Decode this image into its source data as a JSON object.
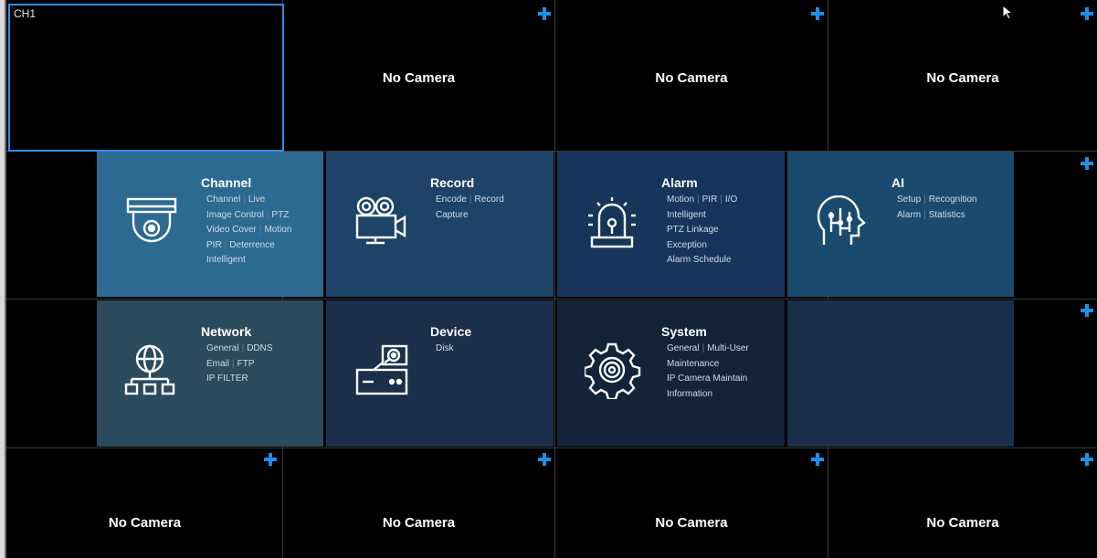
{
  "top_row": {
    "channel_label": "CH1",
    "cells": [
      "No Camera",
      "No Camera",
      "No Camera"
    ]
  },
  "bottom_row": {
    "cells": [
      "No Camera",
      "No Camera",
      "No Camera",
      "No Camera"
    ]
  },
  "menu": {
    "channel": {
      "title": "Channel",
      "lines": [
        [
          "Channel",
          "Live"
        ],
        [
          "Image Control",
          "PTZ"
        ],
        [
          "Video Cover",
          "Motion"
        ],
        [
          "PIR",
          "Deterrence"
        ],
        [
          "Intelligent"
        ]
      ]
    },
    "record": {
      "title": "Record",
      "lines": [
        [
          "Encode",
          "Record"
        ],
        [
          "Capture"
        ]
      ]
    },
    "alarm": {
      "title": "Alarm",
      "lines": [
        [
          "Motion",
          "PIR",
          "I/O"
        ],
        [
          "Intelligent"
        ],
        [
          "PTZ Linkage"
        ],
        [
          "Exception"
        ],
        [
          "Alarm Schedule"
        ]
      ]
    },
    "ai": {
      "title": "AI",
      "lines": [
        [
          "Setup",
          "Recognition"
        ],
        [
          "Alarm",
          "Statistics"
        ]
      ]
    },
    "network": {
      "title": "Network",
      "lines": [
        [
          "General",
          "DDNS"
        ],
        [
          "Email",
          "FTP"
        ],
        [
          "IP FILTER"
        ]
      ]
    },
    "device": {
      "title": "Device",
      "lines": [
        [
          "Disk"
        ]
      ]
    },
    "system": {
      "title": "System",
      "lines": [
        [
          "General",
          "Multi-User"
        ],
        [
          "Maintenance"
        ],
        [
          "IP Camera Maintain"
        ],
        [
          "Information"
        ]
      ]
    }
  },
  "colors": {
    "accent": "#1e90e6",
    "tile_channel": "#2d6a92",
    "tile_record": "#1d4467",
    "tile_alarm": "#17355a",
    "tile_ai": "#1a4b6e",
    "tile_network": "#2b4a5d",
    "tile_device": "#1a2f4a",
    "tile_system": "#13243a",
    "tile_empty": "#1a2f4a"
  }
}
